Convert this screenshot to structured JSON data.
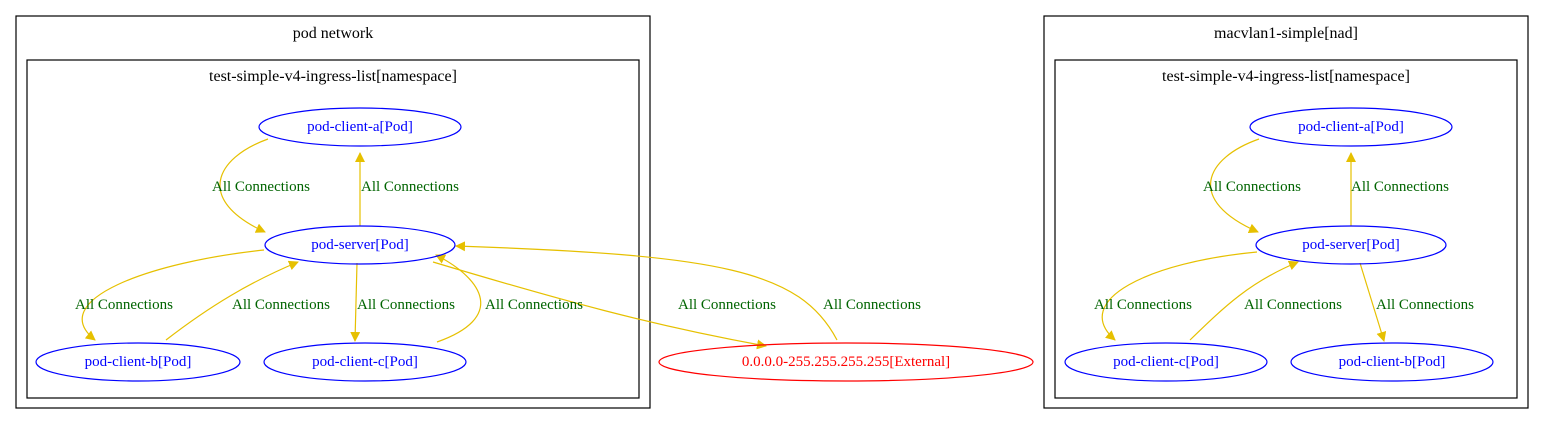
{
  "colors": {
    "pod": "#0000ff",
    "external": "#ff0000",
    "edge": "#e6c000",
    "edge_label": "#006400",
    "cluster_border": "#000000"
  },
  "clusters": {
    "pod_network": {
      "title": "pod network",
      "namespace": "test-simple-v4-ingress-list[namespace]"
    },
    "macvlan": {
      "title": "macvlan1-simple[nad]",
      "namespace": "test-simple-v4-ingress-list[namespace]"
    }
  },
  "nodes": {
    "left_client_a": "pod-client-a[Pod]",
    "left_server": "pod-server[Pod]",
    "left_client_b": "pod-client-b[Pod]",
    "left_client_c": "pod-client-c[Pod]",
    "external": "0.0.0.0-255.255.255.255[External]",
    "right_client_a": "pod-client-a[Pod]",
    "right_server": "pod-server[Pod]",
    "right_client_c": "pod-client-c[Pod]",
    "right_client_b": "pod-client-b[Pod]"
  },
  "edges": [
    {
      "from": "left_client_a",
      "to": "left_server",
      "label": "All Connections"
    },
    {
      "from": "left_server",
      "to": "left_client_a",
      "label": "All Connections"
    },
    {
      "from": "left_server",
      "to": "left_client_b",
      "label": "All Connections"
    },
    {
      "from": "left_client_b",
      "to": "left_server",
      "label": "All Connections"
    },
    {
      "from": "left_server",
      "to": "left_client_c",
      "label": "All Connections"
    },
    {
      "from": "left_client_c",
      "to": "left_server",
      "label": "All Connections"
    },
    {
      "from": "left_server",
      "to": "external",
      "label": "All Connections"
    },
    {
      "from": "external",
      "to": "left_server",
      "label": "All Connections"
    },
    {
      "from": "right_client_a",
      "to": "right_server",
      "label": "All Connections"
    },
    {
      "from": "right_server",
      "to": "right_client_a",
      "label": "All Connections"
    },
    {
      "from": "right_server",
      "to": "right_client_c",
      "label": "All Connections"
    },
    {
      "from": "right_client_c",
      "to": "right_server",
      "label": "All Connections"
    },
    {
      "from": "right_server",
      "to": "right_client_b",
      "label": "All Connections"
    }
  ]
}
